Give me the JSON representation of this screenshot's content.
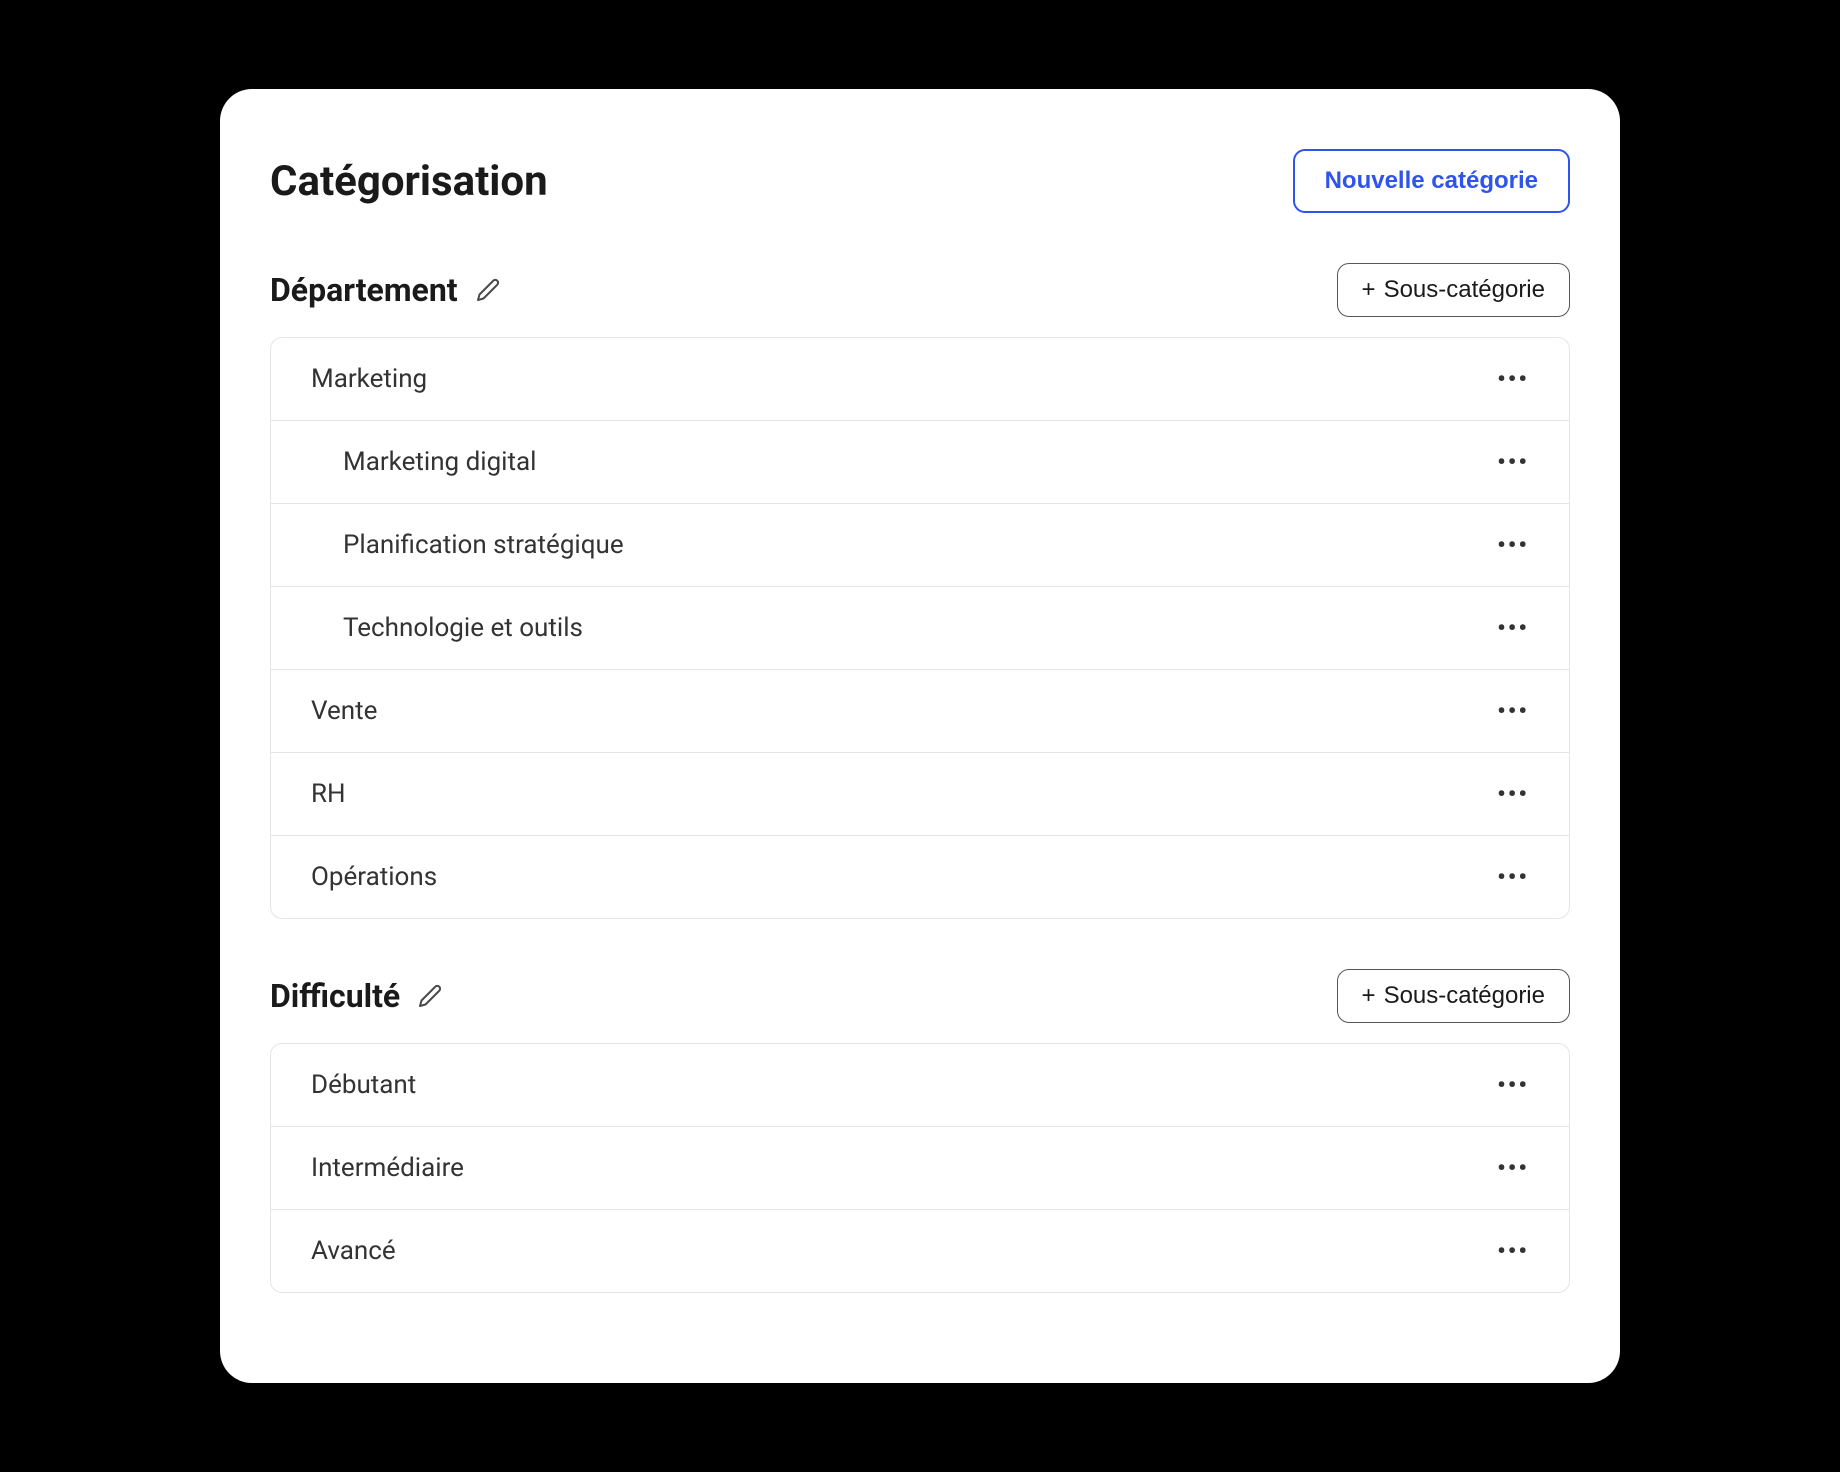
{
  "header": {
    "title": "Catégorisation",
    "new_category_label": "Nouvelle catégorie"
  },
  "sections": [
    {
      "title": "Département",
      "add_sub_label": "Sous-catégorie",
      "items": [
        {
          "label": "Marketing",
          "level": 0
        },
        {
          "label": "Marketing digital",
          "level": 1
        },
        {
          "label": "Planification stratégique",
          "level": 1
        },
        {
          "label": "Technologie et outils",
          "level": 1
        },
        {
          "label": "Vente",
          "level": 0
        },
        {
          "label": "RH",
          "level": 0
        },
        {
          "label": "Opérations",
          "level": 0
        }
      ]
    },
    {
      "title": "Difficulté",
      "add_sub_label": "Sous-catégorie",
      "items": [
        {
          "label": "Débutant",
          "level": 0
        },
        {
          "label": "Intermédiaire",
          "level": 0
        },
        {
          "label": "Avancé",
          "level": 0
        }
      ]
    }
  ]
}
